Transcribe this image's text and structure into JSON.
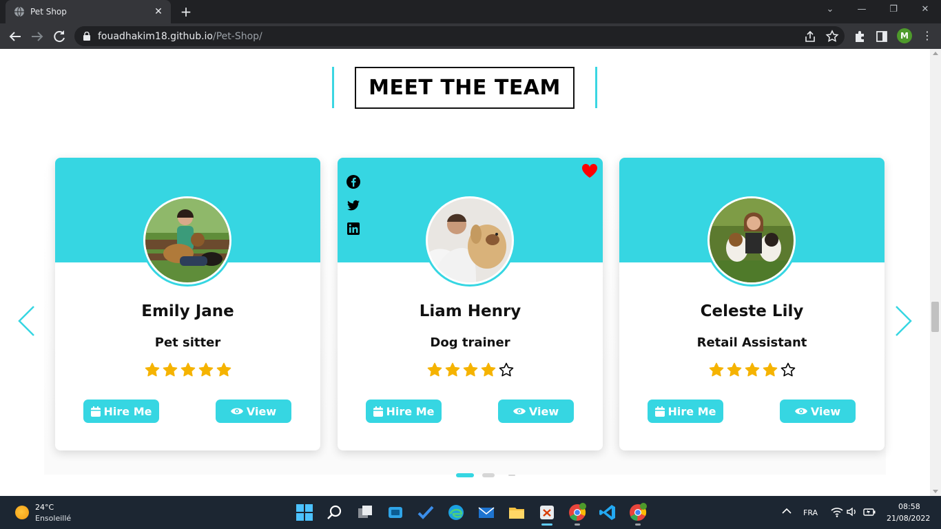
{
  "browser": {
    "tab_title": "Pet Shop",
    "tab_close": "✕",
    "new_tab": "+",
    "url_host": "fouadhakim18.github.io",
    "url_path": "/Pet-Shop/",
    "profile_initial": "M"
  },
  "section": {
    "title": "MEET THE TEAM"
  },
  "team": [
    {
      "name": "Emily Jane",
      "role": "Pet sitter",
      "rating": 5,
      "max_rating": 5,
      "hire_label": "Hire Me",
      "view_label": "View"
    },
    {
      "name": "Liam Henry",
      "role": "Dog trainer",
      "rating": 4,
      "max_rating": 5,
      "hire_label": "Hire Me",
      "view_label": "View"
    },
    {
      "name": "Celeste Lily",
      "role": "Retail Assistant",
      "rating": 4,
      "max_rating": 5,
      "hire_label": "Hire Me",
      "view_label": "View"
    }
  ],
  "carousel": {
    "active_index": 0,
    "dot_count": 3
  },
  "colors": {
    "accent": "#36d6e2",
    "star": "#f5b301",
    "heart": "#ff0000",
    "taskbar": "#1c2632"
  },
  "taskbar": {
    "weather_temp": "24°C",
    "weather_desc": "Ensoleillé",
    "language": "FRA",
    "time": "08:58",
    "date": "21/08/2022"
  }
}
